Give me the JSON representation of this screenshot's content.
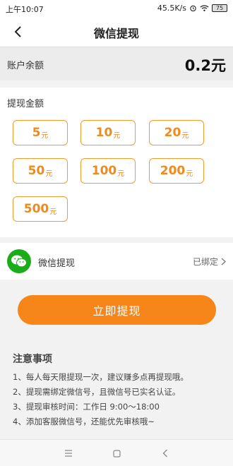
{
  "status_bar": {
    "time": "上午10:07",
    "network_speed": "45.5K/s",
    "battery": "75"
  },
  "header": {
    "title": "微信提现"
  },
  "balance": {
    "label": "账户余额",
    "value": "0.2元"
  },
  "amount": {
    "title": "提现金额",
    "options": [
      {
        "num": "5",
        "unit": "元"
      },
      {
        "num": "10",
        "unit": "元"
      },
      {
        "num": "20",
        "unit": "元"
      },
      {
        "num": "50",
        "unit": "元"
      },
      {
        "num": "100",
        "unit": "元"
      },
      {
        "num": "200",
        "unit": "元"
      },
      {
        "num": "500",
        "unit": "元"
      }
    ]
  },
  "method": {
    "label": "微信提现",
    "status": "已绑定"
  },
  "withdraw_button": "立即提现",
  "notes": {
    "title": "注意事项",
    "items": [
      "1、每人每天限提现一次，建议赚多点再提现哦。",
      "2、提现需绑定微信号，且微信号已实名认证。",
      "3、提现审核时间：工作日 9:00～18:00",
      "4、添加客服微信号，还能优先审核哦~"
    ]
  },
  "colors": {
    "accent": "#f6861a",
    "wechat": "#1aad19"
  }
}
